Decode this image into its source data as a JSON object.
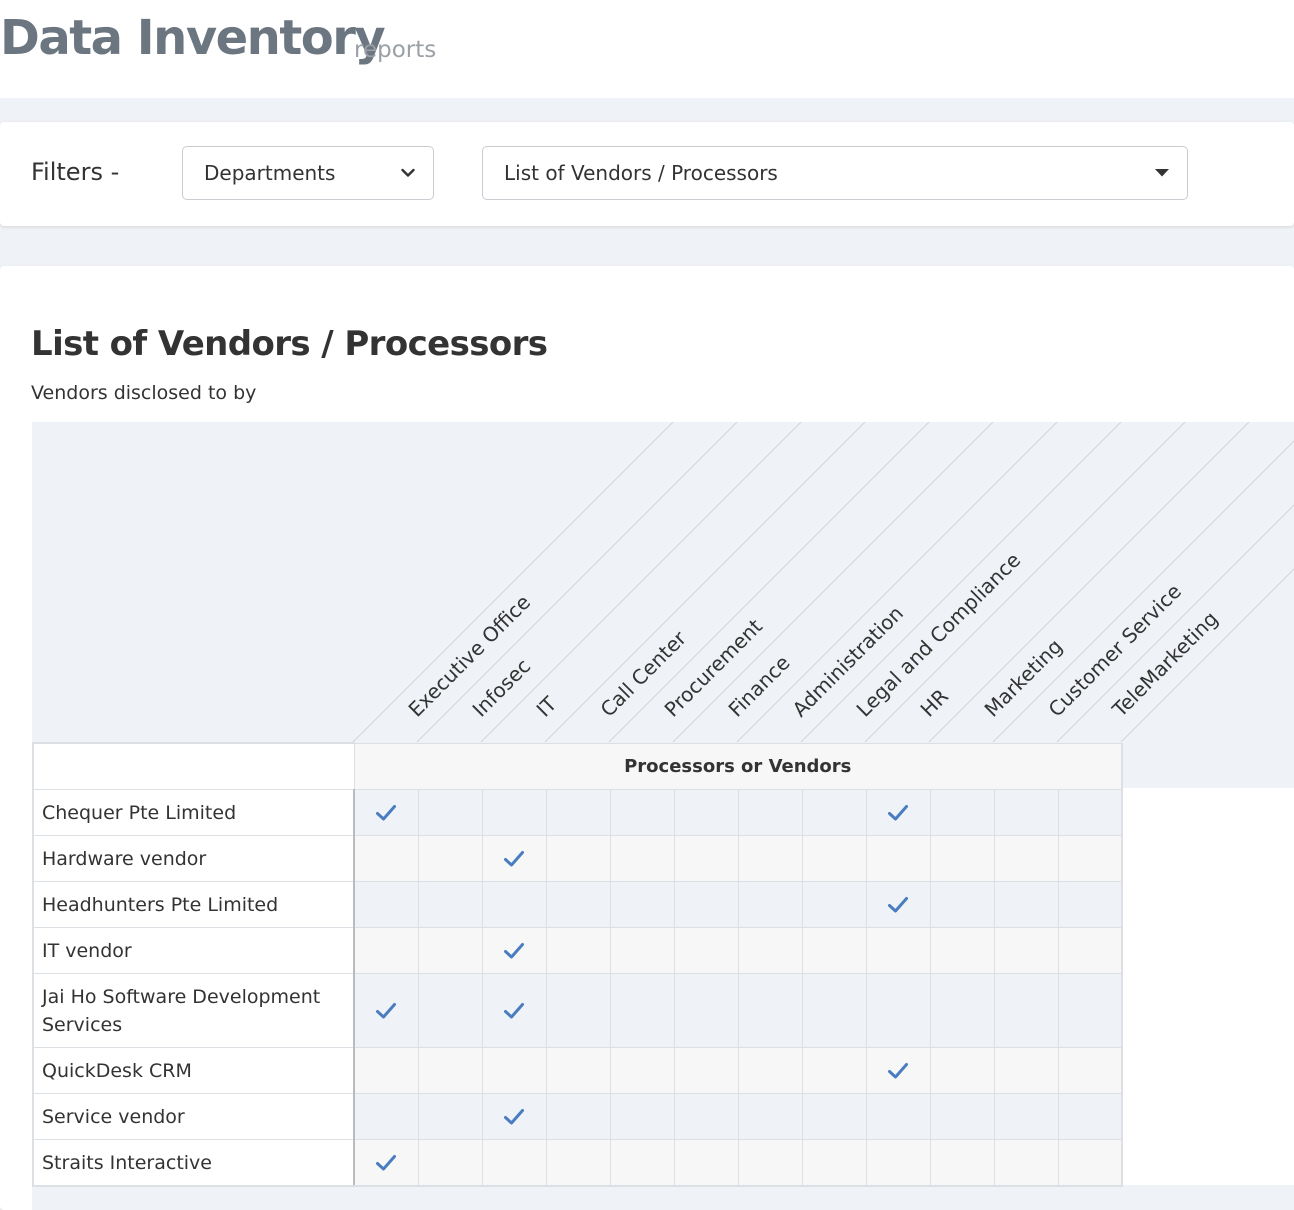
{
  "page": {
    "title": "Data Inventory",
    "subtitle": "reports"
  },
  "filters": {
    "label": "Filters  -",
    "department_select": {
      "value": "Departments",
      "icon": "chevron-down-icon"
    },
    "report_select": {
      "value": "List of Vendors / Processors",
      "icon": "caret-down-icon"
    }
  },
  "report": {
    "title": "List of Vendors / Processors",
    "subtitle": "Vendors disclosed to by",
    "group_header": "Processors or Vendors",
    "check_color": "#4a7dc0",
    "departments": [
      "Executive Office",
      "Infosec",
      "IT",
      "Call Center",
      "Procurement",
      "Finance",
      "Administration",
      "Legal and Compliance",
      "HR",
      "Marketing",
      "Customer Service",
      "TeleMarketing"
    ],
    "rows": [
      {
        "vendor": "Chequer Pte Limited",
        "checks": [
          true,
          false,
          false,
          false,
          false,
          false,
          false,
          false,
          true,
          false,
          false,
          false
        ]
      },
      {
        "vendor": "Hardware vendor",
        "checks": [
          false,
          false,
          true,
          false,
          false,
          false,
          false,
          false,
          false,
          false,
          false,
          false
        ]
      },
      {
        "vendor": "Headhunters Pte Limited",
        "checks": [
          false,
          false,
          false,
          false,
          false,
          false,
          false,
          false,
          true,
          false,
          false,
          false
        ]
      },
      {
        "vendor": "IT vendor",
        "checks": [
          false,
          false,
          true,
          false,
          false,
          false,
          false,
          false,
          false,
          false,
          false,
          false
        ]
      },
      {
        "vendor": "Jai Ho Software Development Services",
        "checks": [
          true,
          false,
          true,
          false,
          false,
          false,
          false,
          false,
          false,
          false,
          false,
          false
        ]
      },
      {
        "vendor": "QuickDesk CRM",
        "checks": [
          false,
          false,
          false,
          false,
          false,
          false,
          false,
          false,
          true,
          false,
          false,
          false
        ]
      },
      {
        "vendor": "Service vendor",
        "checks": [
          false,
          false,
          true,
          false,
          false,
          false,
          false,
          false,
          false,
          false,
          false,
          false
        ]
      },
      {
        "vendor": "Straits Interactive",
        "checks": [
          true,
          false,
          false,
          false,
          false,
          false,
          false,
          false,
          false,
          false,
          false,
          false
        ]
      }
    ]
  }
}
